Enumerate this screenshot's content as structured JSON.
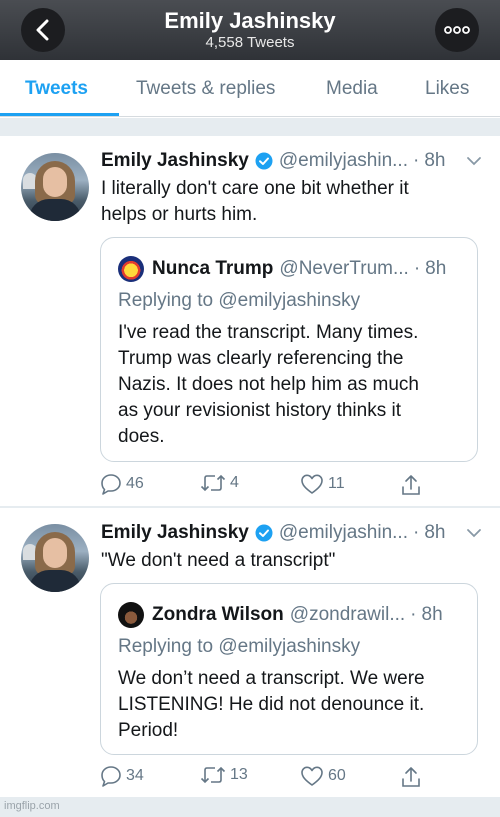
{
  "header": {
    "title": "Emily Jashinsky",
    "subtitle": "4,558 Tweets"
  },
  "tabs": [
    {
      "label": "Tweets",
      "active": true
    },
    {
      "label": "Tweets & replies",
      "active": false
    },
    {
      "label": "Media",
      "active": false
    },
    {
      "label": "Likes",
      "active": false
    }
  ],
  "tweets": [
    {
      "name": "Emily Jashinsky",
      "handle": "@emilyjashin...",
      "time": "8h",
      "text_lines": [
        "I literally don't care one bit whether it",
        "helps or hurts him."
      ],
      "quote": {
        "name": "Nunca Trump",
        "handle": "@NeverTrum...",
        "time": "8h",
        "reply_prefix": "Replying to",
        "reply_to": "@emilyjashinsky",
        "text_lines": [
          "I've read the transcript. Many times.",
          "Trump was clearly referencing the",
          "Nazis. It does not help him as much",
          "as your revisionist history thinks it",
          "does."
        ]
      },
      "replies": "46",
      "retweets": "4",
      "likes": "11"
    },
    {
      "name": "Emily Jashinsky",
      "handle": "@emilyjashin...",
      "time": "8h",
      "text_lines": [
        "\"We don't need a transcript\""
      ],
      "quote": {
        "name": "Zondra Wilson",
        "handle": "@zondrawil...",
        "time": "8h",
        "reply_prefix": "Replying to",
        "reply_to": "@emilyjashinsky",
        "text_lines": [
          "We don’t need a transcript. We were",
          "LISTENING! He did not denounce it.",
          "Period!"
        ]
      },
      "replies": "34",
      "retweets": "13",
      "likes": "60"
    }
  ],
  "watermark": "imgflip.com",
  "icons": {
    "back": "chevron-left-icon",
    "more": "more-icon",
    "verified": "verified-badge-icon",
    "caret": "chevron-down-icon",
    "reply": "reply-icon",
    "retweet": "retweet-icon",
    "like": "heart-icon",
    "share": "share-icon"
  },
  "colors": {
    "accent": "#1da1f2",
    "secondary_text": "#657786",
    "header_bg": "#3a3d42",
    "separator": "#e6ecf0"
  }
}
